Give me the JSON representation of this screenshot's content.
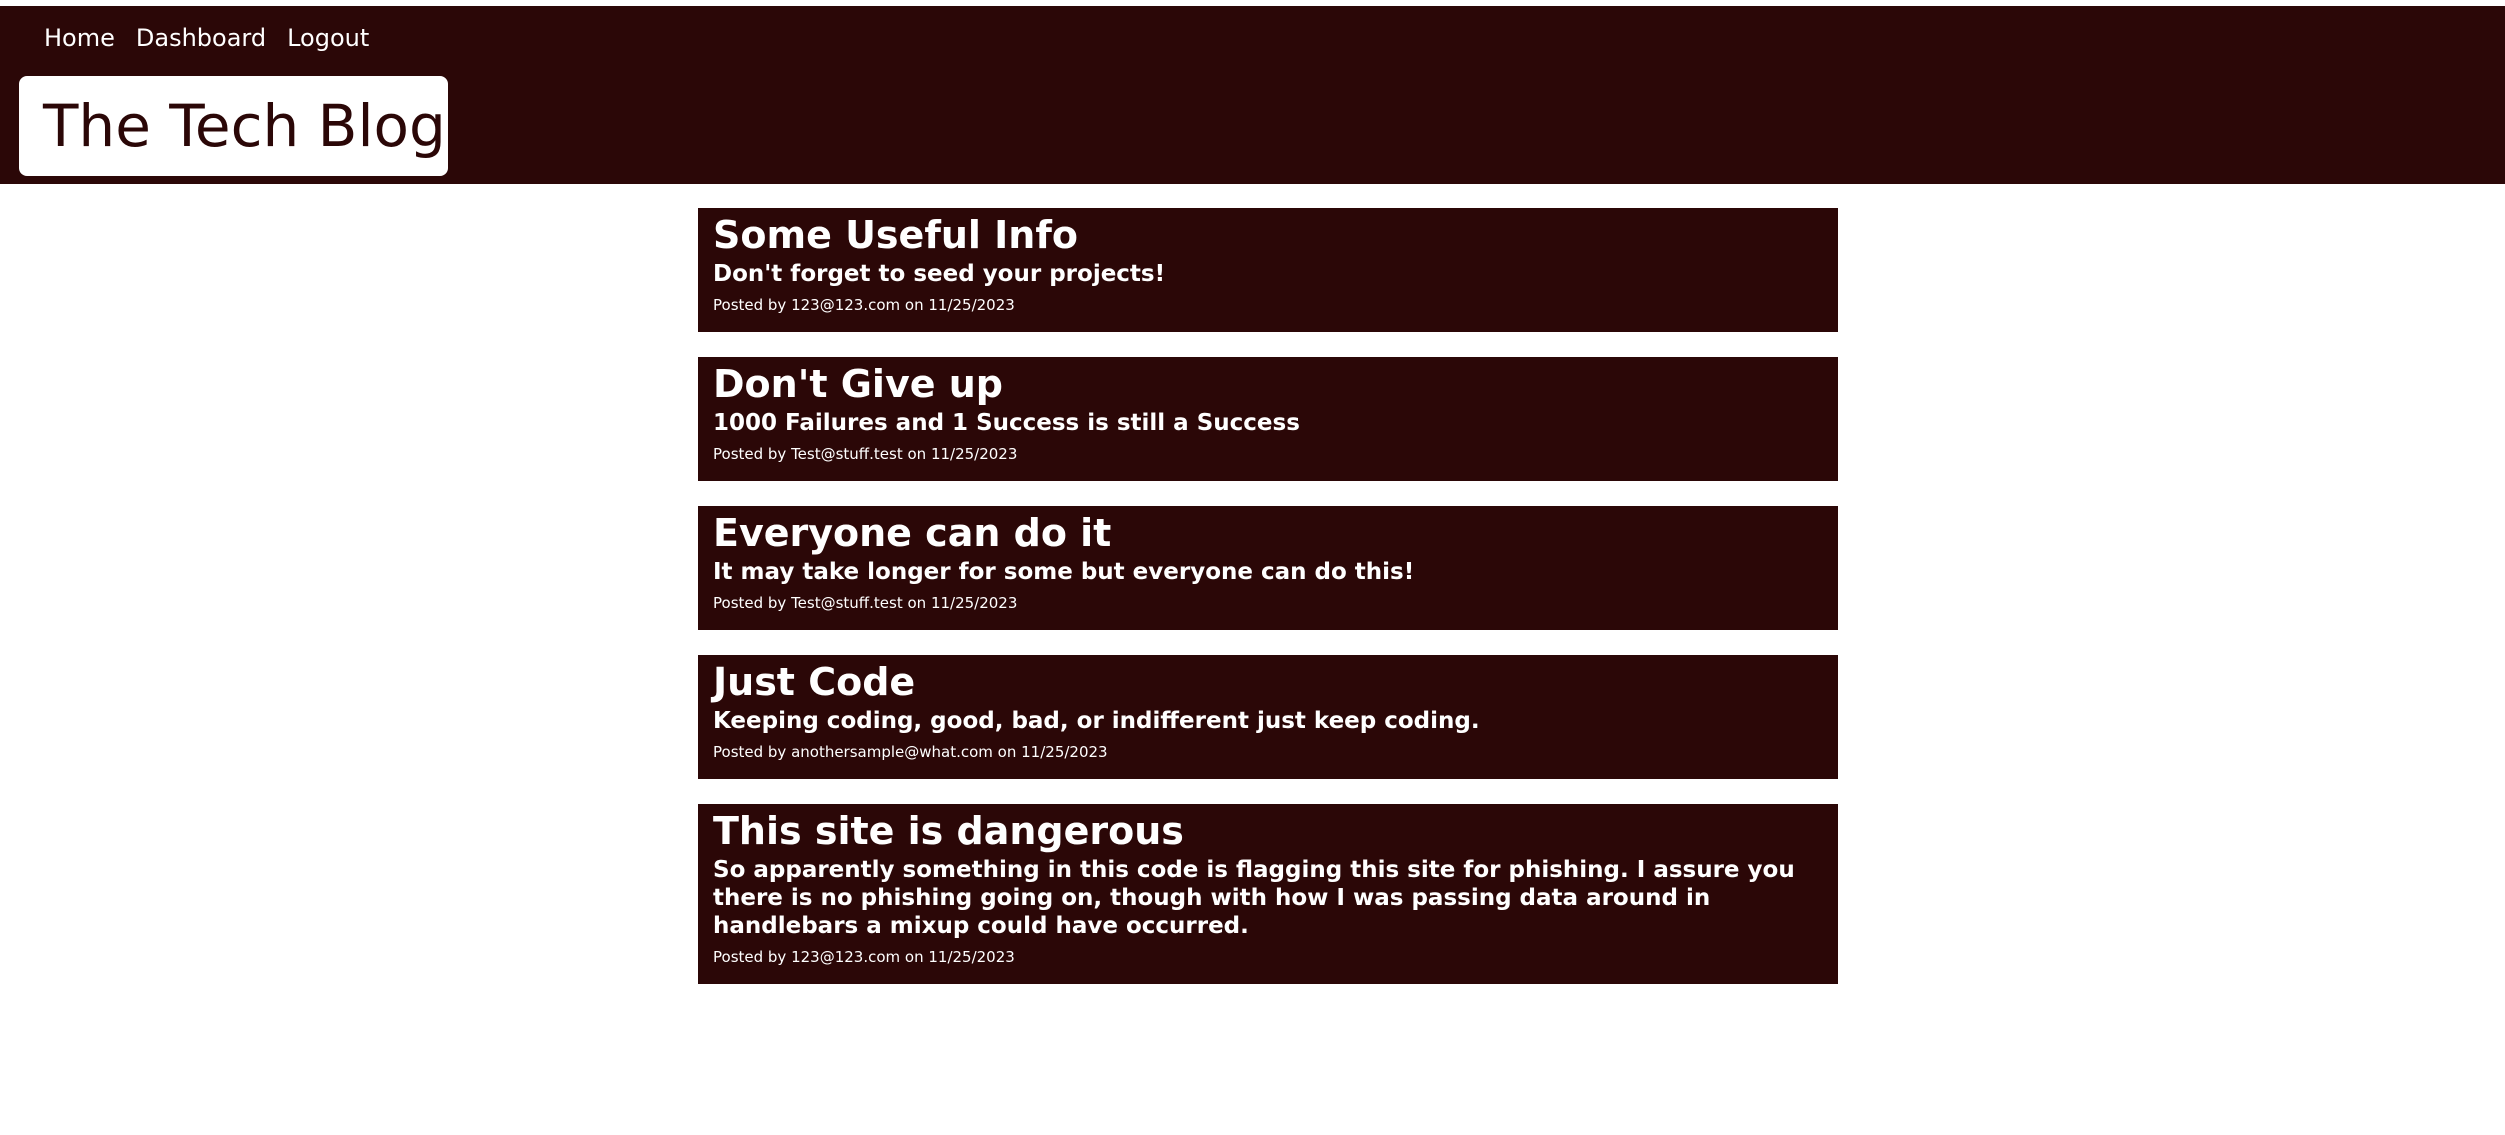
{
  "nav": {
    "home": "Home",
    "dashboard": "Dashboard",
    "logout": "Logout"
  },
  "header": {
    "title": "The Tech Blog"
  },
  "posts": [
    {
      "title": "Some Useful Info",
      "body": "Don't forget to seed your projects!",
      "meta": "Posted by 123@123.com on 11/25/2023"
    },
    {
      "title": "Don't Give up",
      "body": "1000 Failures and 1 Success is still a Success",
      "meta": "Posted by Test@stuff.test on 11/25/2023"
    },
    {
      "title": "Everyone can do it",
      "body": "It may take longer for some but everyone can do this!",
      "meta": "Posted by Test@stuff.test on 11/25/2023"
    },
    {
      "title": "Just Code",
      "body": "Keeping coding, good, bad, or indifferent just keep coding.",
      "meta": "Posted by anothersample@what.com on 11/25/2023"
    },
    {
      "title": "This site is dangerous",
      "body": "So apparently something in this code is flagging this site for phishing. I assure you there is no phishing going on, though with how I was passing data around in handlebars a mixup could have occurred.",
      "meta": "Posted by 123@123.com on 11/25/2023"
    }
  ],
  "colors": {
    "brand": "#2b0707",
    "text_on_brand": "#ffffff",
    "background": "#ffffff"
  }
}
